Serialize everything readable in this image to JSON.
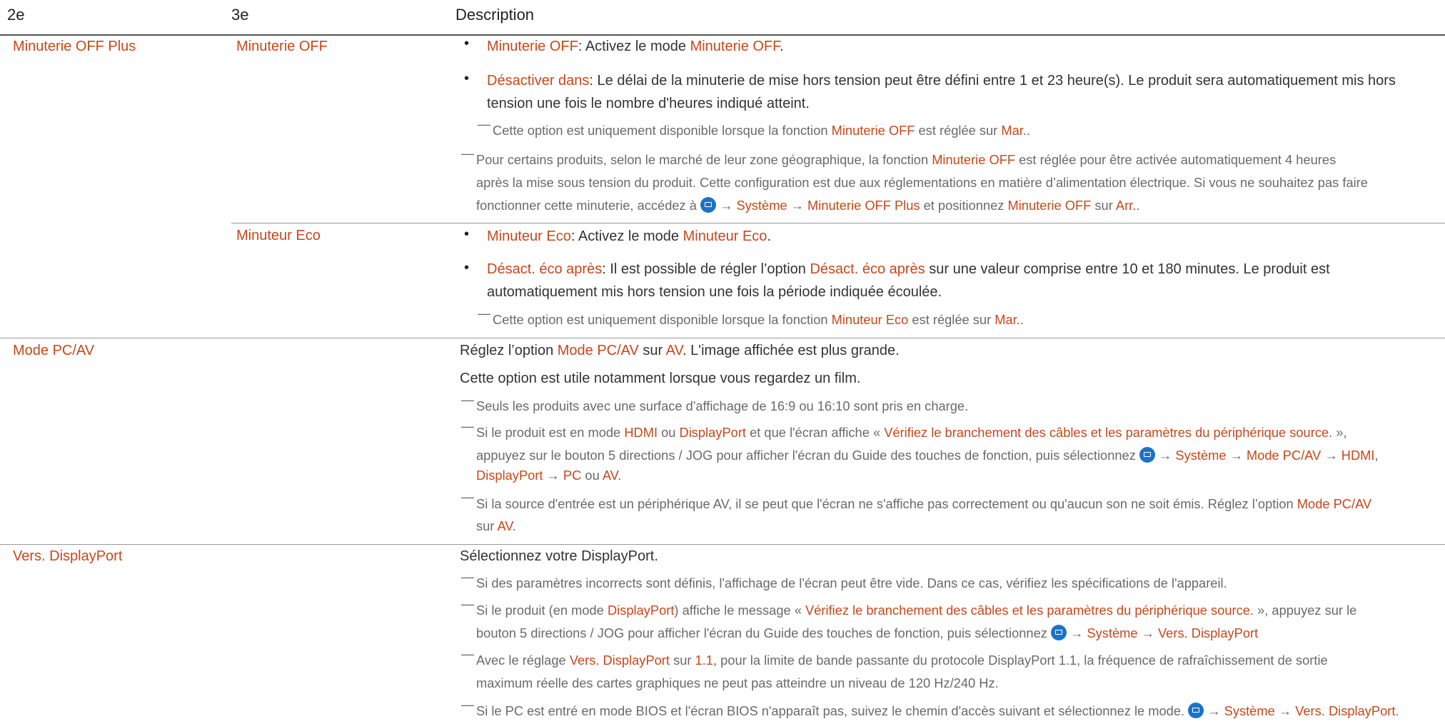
{
  "header": {
    "col2": "2e",
    "col3": "3e",
    "col4": "Description"
  },
  "colors": {
    "accent": "#c8471b",
    "text": "#333333",
    "note": "#6a6a6a",
    "icon": "#1a73c8"
  },
  "rows": {
    "minuterie": {
      "label2": "Minuterie OFF Plus",
      "label3a": "Minuterie OFF",
      "b1": {
        "hl1": "Minuterie OFF",
        "t1": ": Activez le mode ",
        "hl2": "Minuterie OFF",
        "t2": "."
      },
      "b2": {
        "hl1": "Désactiver dans",
        "t1": ": Le délai de la minuterie de mise hors tension peut être défini entre 1 et 23 heure(s). Le produit sera automatiquement mis hors",
        "t2": "tension une fois le nombre d'heures indiqué atteint."
      },
      "n1": {
        "t1": "Cette option est uniquement disponible lorsque la fonction ",
        "hl1": "Minuterie OFF",
        "t2": " est réglée sur ",
        "hl2": "Mar.",
        "t3": "."
      },
      "n2": {
        "l1a": "Pour certains produits, selon le marché de leur zone géographique, la fonction ",
        "l1hl": "Minuterie OFF",
        "l1b": " est réglée pour être activée automatiquement 4 heures",
        "l2": "après la mise sous tension du produit. Cette configuration est due aux réglementations en matière d’alimentation électrique. Si vous ne souhaitez pas faire",
        "l3a": "fonctionner cette minuterie, accédez à ",
        "arrow1": " → ",
        "hl1": "Système",
        "arrow2": " → ",
        "hl2": "Minuterie OFF Plus",
        "t1": " et positionnez ",
        "hl3": "Minuterie OFF",
        "t2": " sur ",
        "hl4": "Arr.",
        "t3": "."
      },
      "label3b": "Minuteur Eco",
      "b3": {
        "hl1": "Minuteur Eco",
        "t1": ": Activez le mode ",
        "hl2": "Minuteur Eco",
        "t2": "."
      },
      "b4": {
        "hl1": "Désact. éco après",
        "t1": ": Il est possible de régler l’option ",
        "hl2": "Désact. éco après",
        "t2": " sur une valeur comprise entre 10 et 180 minutes. Le produit est",
        "t3": "automatiquement mis hors tension une fois la période indiquée écoulée."
      },
      "n3": {
        "t1": "Cette option est uniquement disponible lorsque la fonction ",
        "hl1": "Minuteur Eco",
        "t2": " est réglée sur ",
        "hl2": "Mar.",
        "t3": "."
      }
    },
    "mode": {
      "label2": "Mode PC/AV",
      "p1": {
        "t1": "Réglez l’option ",
        "hl1": "Mode PC/AV",
        "t2": " sur ",
        "hl2": "AV",
        "t3": ". L'image affichée est plus grande."
      },
      "p2": "Cette option est utile notamment lorsque vous regardez un film.",
      "n1": "Seuls les produits avec une surface d'affichage de 16:9 ou 16:10 sont pris en charge.",
      "n2": {
        "t1": "Si le produit est en mode ",
        "hl1": "HDMI",
        "t2": " ou ",
        "hl2": "DisplayPort",
        "t3": " et que l'écran affiche « ",
        "hl3": "Vérifiez le branchement des câbles et les paramètres du périphérique source.",
        "t4": " »,",
        "l2a": "appuyez sur le bouton 5 directions / JOG pour afficher l'écran du Guide des touches de fonction, puis sélectionnez ",
        "a1": " → ",
        "hl4": "Système",
        "a2": " → ",
        "hl5": "Mode PC/AV",
        "a3": " → ",
        "hl6": "HDMI",
        "t5": ",",
        "l3hl1": "DisplayPort",
        "a4": " → ",
        "l3hl2": "PC",
        "t6": " ou ",
        "l3hl3": "AV",
        "t7": "."
      },
      "n3": {
        "t1": "Si la source d'entrée est un périphérique AV, il se peut que l'écran ne s'affiche pas correctement ou qu'aucun son ne soit émis. Réglez l’option ",
        "hl1": "Mode PC/AV",
        "l2a": "sur ",
        "hl2": "AV",
        "t2": "."
      }
    },
    "vers": {
      "label2": "Vers. DisplayPort",
      "p1": "Sélectionnez votre DisplayPort.",
      "n1": "Si des paramètres incorrects sont définis, l'affichage de l'écran peut être vide. Dans ce cas, vérifiez les spécifications de l'appareil.",
      "n2": {
        "t1": "Si le produit (en mode ",
        "hl1": "DisplayPort",
        "t2": ") affiche le message « ",
        "hl2": "Vérifiez le branchement des câbles et les paramètres du périphérique source.",
        "t3": " », appuyez sur le",
        "l2a": "bouton 5 directions / JOG pour afficher l'écran du Guide des touches de fonction, puis sélectionnez ",
        "a1": " → ",
        "hl3": "Système",
        "a2": " → ",
        "hl4": "Vers. DisplayPort"
      },
      "n3": {
        "t1": "Avec le réglage ",
        "hl1": "Vers. DisplayPort",
        "t2": " sur ",
        "hl2": "1.1",
        "t3": ", pour la limite de bande passante du protocole DisplayPort 1.1, la fréquence de rafraîchissement de sortie",
        "l2": "maximum réelle des cartes graphiques ne peut pas atteindre un niveau de 120 Hz/240 Hz."
      },
      "n4": {
        "t1": "Si le PC est entré en mode BIOS et l'écran BIOS n'apparaît pas, suivez le chemin d'accès suivant et sélectionnez le mode. ",
        "a1": " → ",
        "hl1": "Système",
        "a2": " → ",
        "hl2": "Vers. DisplayPort",
        "t2": "."
      }
    }
  },
  "dash": "—",
  "bullet": "•",
  "icon": "menu-icon"
}
